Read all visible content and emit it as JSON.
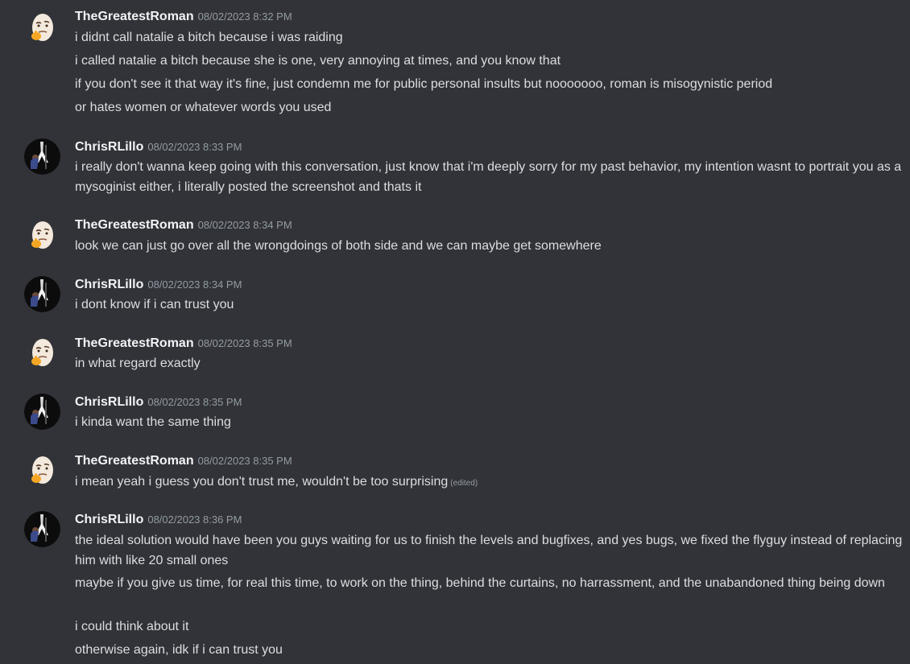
{
  "users": {
    "roman": "TheGreatestRoman",
    "chris": "ChrisRLillo"
  },
  "groups": [
    {
      "author": "TheGreatestRoman",
      "time": "08/02/2023 8:32 PM",
      "lines": [
        "i didnt call natalie a bitch because i was raiding",
        "i called natalie a bitch because she is one, very annoying at times, and you know that",
        "if you don't see it that way it's fine, just condemn me for public personal insults but nooooooo, roman is misogynistic period",
        "or hates women or whatever words you used"
      ]
    },
    {
      "author": "ChrisRLillo",
      "time": "08/02/2023 8:33 PM",
      "lines": [
        "i really don't wanna keep going with this conversation, just know that i'm deeply sorry for my past behavior, my intention wasnt to portrait you as a mysoginist either, i literally posted the screenshot and thats it"
      ]
    },
    {
      "author": "TheGreatestRoman",
      "time": "08/02/2023 8:34 PM",
      "lines": [
        "look we can just go over all the wrongdoings of both side and we can maybe get somewhere"
      ]
    },
    {
      "author": "ChrisRLillo",
      "time": "08/02/2023 8:34 PM",
      "lines": [
        "i dont know if i can trust you"
      ]
    },
    {
      "author": "TheGreatestRoman",
      "time": "08/02/2023 8:35 PM",
      "lines": [
        "in what regard exactly"
      ]
    },
    {
      "author": "ChrisRLillo",
      "time": "08/02/2023 8:35 PM",
      "lines": [
        "i kinda want the same thing"
      ]
    },
    {
      "author": "TheGreatestRoman",
      "time": "08/02/2023 8:35 PM",
      "lines": [
        "i mean yeah i guess you don't trust me, wouldn't be too surprising"
      ],
      "edited": "(edited)"
    },
    {
      "author": "ChrisRLillo",
      "time": "08/02/2023 8:36 PM",
      "lines": [
        "the ideal solution would have been you guys waiting for us to finish the levels and bugfixes, and yes bugs, we fixed the flyguy instead of replacing him with like 20 small ones",
        "maybe if you give us time, for real this time, to work on the thing, behind the curtains, no harrassment, and the unabandoned thing being down",
        "i could think about it",
        "otherwise again, idk if i can trust you"
      ]
    }
  ],
  "icons": {
    "roman_avatar": "thinking-egg-avatar-icon",
    "chris_avatar": "guitarist-avatar-icon"
  },
  "colors": {
    "background": "#313338",
    "username": "#f2f3f5",
    "message_text": "#dbdee1",
    "timestamp": "#949ba4"
  }
}
